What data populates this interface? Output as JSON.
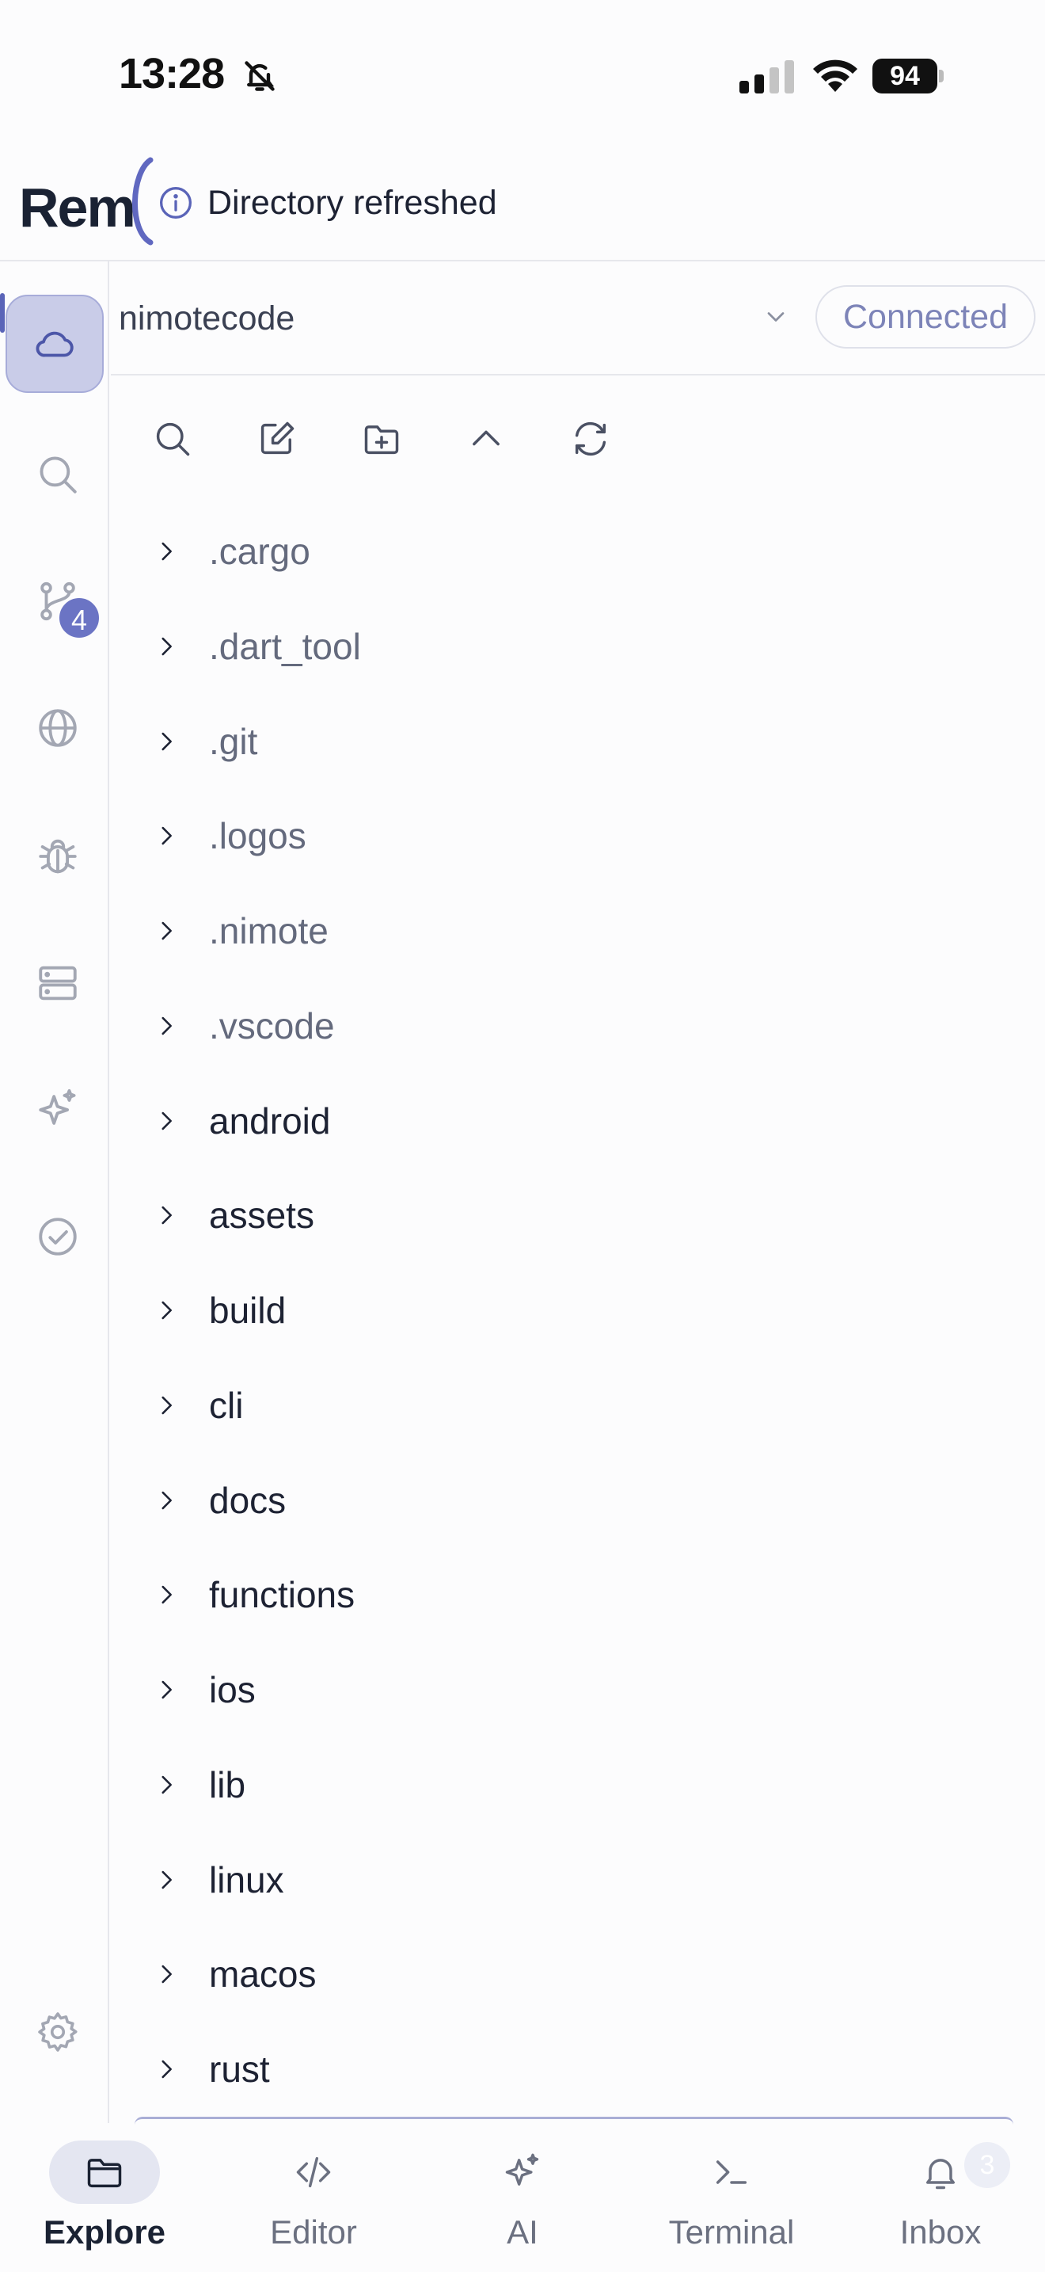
{
  "status_bar": {
    "time": "13:28",
    "battery": "94"
  },
  "header": {
    "logo": "Rem",
    "toast": "Directory refreshed"
  },
  "rail": {
    "source_control_badge": "4"
  },
  "project": {
    "name": "nimotecode",
    "status": "Connected"
  },
  "files": [
    {
      "name": ".cargo"
    },
    {
      "name": ".dart_tool"
    },
    {
      "name": ".git"
    },
    {
      "name": ".logos"
    },
    {
      "name": ".nimote"
    },
    {
      "name": ".vscode"
    },
    {
      "name": "android"
    },
    {
      "name": "assets"
    },
    {
      "name": "build"
    },
    {
      "name": "cli"
    },
    {
      "name": "docs"
    },
    {
      "name": "functions"
    },
    {
      "name": "ios"
    },
    {
      "name": "lib"
    },
    {
      "name": "linux"
    },
    {
      "name": "macos"
    },
    {
      "name": "rust"
    }
  ],
  "bottom_nav": {
    "explore": "Explore",
    "editor": "Editor",
    "ai": "AI",
    "terminal": "Terminal",
    "inbox": "Inbox",
    "inbox_badge": "3"
  },
  "colors": {
    "accent": "#5a64b8",
    "active_rail_bg": "#c9cce8",
    "connected_text": "#7d84b8"
  }
}
